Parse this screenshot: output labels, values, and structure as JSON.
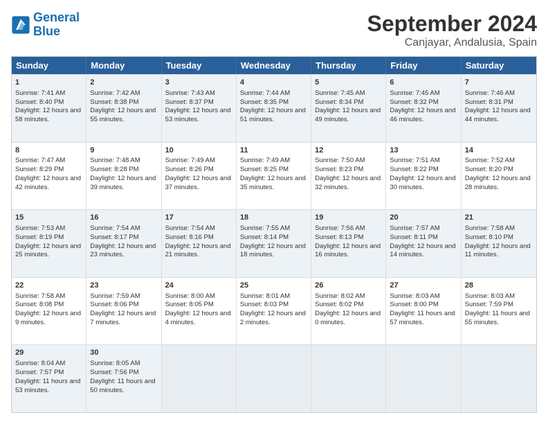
{
  "logo": {
    "line1": "General",
    "line2": "Blue"
  },
  "title": "September 2024",
  "location": "Canjayar, Andalusia, Spain",
  "days": [
    "Sunday",
    "Monday",
    "Tuesday",
    "Wednesday",
    "Thursday",
    "Friday",
    "Saturday"
  ],
  "rows": [
    [
      {
        "num": "1",
        "rise": "7:41 AM",
        "set": "8:40 PM",
        "daylight": "12 hours and 58 minutes."
      },
      {
        "num": "2",
        "rise": "7:42 AM",
        "set": "8:38 PM",
        "daylight": "12 hours and 55 minutes."
      },
      {
        "num": "3",
        "rise": "7:43 AM",
        "set": "8:37 PM",
        "daylight": "12 hours and 53 minutes."
      },
      {
        "num": "4",
        "rise": "7:44 AM",
        "set": "8:35 PM",
        "daylight": "12 hours and 51 minutes."
      },
      {
        "num": "5",
        "rise": "7:45 AM",
        "set": "8:34 PM",
        "daylight": "12 hours and 49 minutes."
      },
      {
        "num": "6",
        "rise": "7:45 AM",
        "set": "8:32 PM",
        "daylight": "12 hours and 46 minutes."
      },
      {
        "num": "7",
        "rise": "7:46 AM",
        "set": "8:31 PM",
        "daylight": "12 hours and 44 minutes."
      }
    ],
    [
      {
        "num": "8",
        "rise": "7:47 AM",
        "set": "8:29 PM",
        "daylight": "12 hours and 42 minutes."
      },
      {
        "num": "9",
        "rise": "7:48 AM",
        "set": "8:28 PM",
        "daylight": "12 hours and 39 minutes."
      },
      {
        "num": "10",
        "rise": "7:49 AM",
        "set": "8:26 PM",
        "daylight": "12 hours and 37 minutes."
      },
      {
        "num": "11",
        "rise": "7:49 AM",
        "set": "8:25 PM",
        "daylight": "12 hours and 35 minutes."
      },
      {
        "num": "12",
        "rise": "7:50 AM",
        "set": "8:23 PM",
        "daylight": "12 hours and 32 minutes."
      },
      {
        "num": "13",
        "rise": "7:51 AM",
        "set": "8:22 PM",
        "daylight": "12 hours and 30 minutes."
      },
      {
        "num": "14",
        "rise": "7:52 AM",
        "set": "8:20 PM",
        "daylight": "12 hours and 28 minutes."
      }
    ],
    [
      {
        "num": "15",
        "rise": "7:53 AM",
        "set": "8:19 PM",
        "daylight": "12 hours and 25 minutes."
      },
      {
        "num": "16",
        "rise": "7:54 AM",
        "set": "8:17 PM",
        "daylight": "12 hours and 23 minutes."
      },
      {
        "num": "17",
        "rise": "7:54 AM",
        "set": "8:16 PM",
        "daylight": "12 hours and 21 minutes."
      },
      {
        "num": "18",
        "rise": "7:55 AM",
        "set": "8:14 PM",
        "daylight": "12 hours and 18 minutes."
      },
      {
        "num": "19",
        "rise": "7:56 AM",
        "set": "8:13 PM",
        "daylight": "12 hours and 16 minutes."
      },
      {
        "num": "20",
        "rise": "7:57 AM",
        "set": "8:11 PM",
        "daylight": "12 hours and 14 minutes."
      },
      {
        "num": "21",
        "rise": "7:58 AM",
        "set": "8:10 PM",
        "daylight": "12 hours and 11 minutes."
      }
    ],
    [
      {
        "num": "22",
        "rise": "7:58 AM",
        "set": "8:08 PM",
        "daylight": "12 hours and 9 minutes."
      },
      {
        "num": "23",
        "rise": "7:59 AM",
        "set": "8:06 PM",
        "daylight": "12 hours and 7 minutes."
      },
      {
        "num": "24",
        "rise": "8:00 AM",
        "set": "8:05 PM",
        "daylight": "12 hours and 4 minutes."
      },
      {
        "num": "25",
        "rise": "8:01 AM",
        "set": "8:03 PM",
        "daylight": "12 hours and 2 minutes."
      },
      {
        "num": "26",
        "rise": "8:02 AM",
        "set": "8:02 PM",
        "daylight": "12 hours and 0 minutes."
      },
      {
        "num": "27",
        "rise": "8:03 AM",
        "set": "8:00 PM",
        "daylight": "11 hours and 57 minutes."
      },
      {
        "num": "28",
        "rise": "8:03 AM",
        "set": "7:59 PM",
        "daylight": "11 hours and 55 minutes."
      }
    ],
    [
      {
        "num": "29",
        "rise": "8:04 AM",
        "set": "7:57 PM",
        "daylight": "11 hours and 53 minutes."
      },
      {
        "num": "30",
        "rise": "8:05 AM",
        "set": "7:56 PM",
        "daylight": "11 hours and 50 minutes."
      },
      null,
      null,
      null,
      null,
      null
    ]
  ]
}
